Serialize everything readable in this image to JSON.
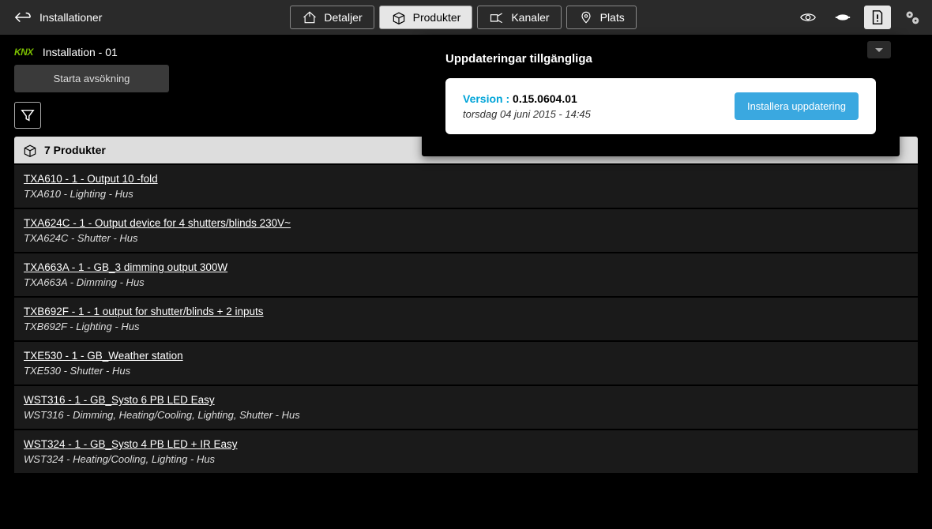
{
  "topbar": {
    "back_label": "Installationer",
    "nav": {
      "details": "Detaljer",
      "products": "Produkter",
      "channels": "Kanaler",
      "place": "Plats"
    }
  },
  "subheader": {
    "logo_text": "KNX",
    "installation_name": "Installation - 01"
  },
  "scan_button": "Starta avsökning",
  "list_header": "7 Produkter",
  "products": [
    {
      "title": "TXA610 - 1 - Output 10 -fold",
      "sub": "TXA610 - Lighting - Hus"
    },
    {
      "title": "TXA624C - 1 - Output device for 4 shutters/blinds 230V~",
      "sub": "TXA624C - Shutter - Hus"
    },
    {
      "title": "TXA663A - 1 - GB_3 dimming output 300W",
      "sub": "TXA663A - Dimming - Hus"
    },
    {
      "title": "TXB692F - 1 - 1 output for shutter/blinds + 2 inputs",
      "sub": "TXB692F - Lighting - Hus"
    },
    {
      "title": "TXE530 - 1 - GB_Weather station",
      "sub": "TXE530 - Shutter - Hus"
    },
    {
      "title": "WST316 - 1 - GB_Systo 6 PB LED Easy",
      "sub": "WST316 - Dimming, Heating/Cooling, Lighting, Shutter - Hus"
    },
    {
      "title": "WST324 - 1 - GB_Systo 4 PB LED + IR Easy",
      "sub": "WST324 - Heating/Cooling, Lighting - Hus"
    }
  ],
  "update_panel": {
    "title": "Uppdateringar tillgängliga",
    "version_label": "Version : ",
    "version_value": "0.15.0604.01",
    "date": "torsdag 04 juni 2015 - 14:45",
    "install_button": "Installera uppdatering"
  }
}
